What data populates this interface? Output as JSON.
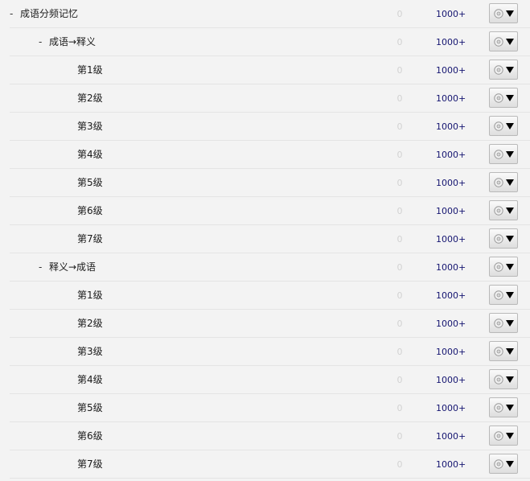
{
  "tree": {
    "rows": [
      {
        "level": 0,
        "toggle": "-",
        "label": "成语分频记忆",
        "count_a": "0",
        "count_b": "1000+"
      },
      {
        "level": 1,
        "toggle": "-",
        "label": "成语→释义",
        "count_a": "0",
        "count_b": "1000+"
      },
      {
        "level": 2,
        "toggle": "",
        "label": "第1级",
        "count_a": "0",
        "count_b": "1000+"
      },
      {
        "level": 2,
        "toggle": "",
        "label": "第2级",
        "count_a": "0",
        "count_b": "1000+"
      },
      {
        "level": 2,
        "toggle": "",
        "label": "第3级",
        "count_a": "0",
        "count_b": "1000+"
      },
      {
        "level": 2,
        "toggle": "",
        "label": "第4级",
        "count_a": "0",
        "count_b": "1000+"
      },
      {
        "level": 2,
        "toggle": "",
        "label": "第5级",
        "count_a": "0",
        "count_b": "1000+"
      },
      {
        "level": 2,
        "toggle": "",
        "label": "第6级",
        "count_a": "0",
        "count_b": "1000+"
      },
      {
        "level": 2,
        "toggle": "",
        "label": "第7级",
        "count_a": "0",
        "count_b": "1000+"
      },
      {
        "level": 1,
        "toggle": "-",
        "label": "释义→成语",
        "count_a": "0",
        "count_b": "1000+"
      },
      {
        "level": 2,
        "toggle": "",
        "label": "第1级",
        "count_a": "0",
        "count_b": "1000+"
      },
      {
        "level": 2,
        "toggle": "",
        "label": "第2级",
        "count_a": "0",
        "count_b": "1000+"
      },
      {
        "level": 2,
        "toggle": "",
        "label": "第3级",
        "count_a": "0",
        "count_b": "1000+"
      },
      {
        "level": 2,
        "toggle": "",
        "label": "第4级",
        "count_a": "0",
        "count_b": "1000+"
      },
      {
        "level": 2,
        "toggle": "",
        "label": "第5级",
        "count_a": "0",
        "count_b": "1000+"
      },
      {
        "level": 2,
        "toggle": "",
        "label": "第6级",
        "count_a": "0",
        "count_b": "1000+"
      },
      {
        "level": 2,
        "toggle": "",
        "label": "第7级",
        "count_a": "0",
        "count_b": "1000+"
      }
    ]
  },
  "icons": {
    "action_gear": "gear-icon",
    "action_caret": "caret-down-icon"
  },
  "colors": {
    "background": "#f3f3f3",
    "count_b": "#141470",
    "count_a": "#d2d2d2"
  }
}
